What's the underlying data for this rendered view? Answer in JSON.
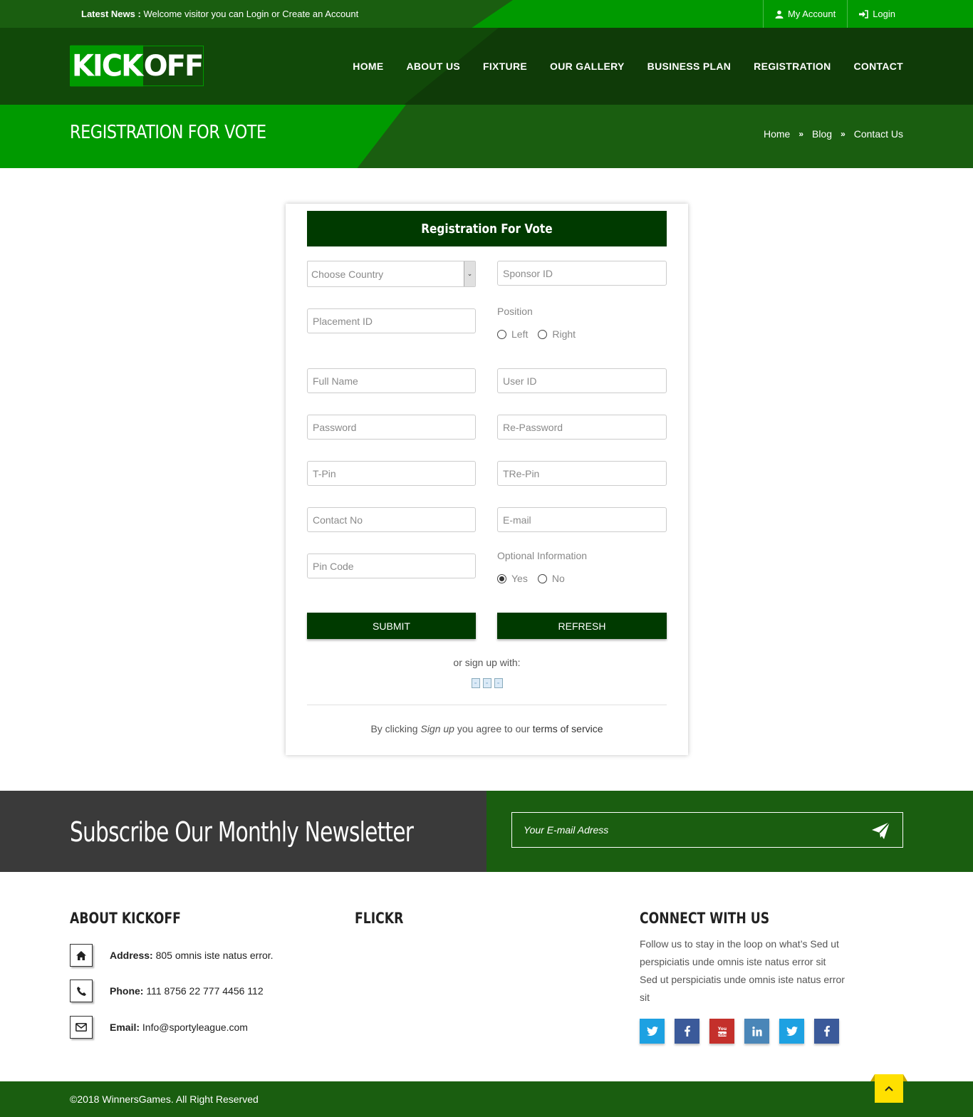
{
  "topbar": {
    "news_label": "Latest News :",
    "news_text": "Welcome visitor you can Login or Create an Account",
    "my_account": "My Account",
    "login": "Login"
  },
  "logo": {
    "part1": "KICK",
    "part2": "OFF"
  },
  "nav": [
    "HOME",
    "ABOUT US",
    "FIXTURE",
    "OUR GALLERY",
    "BUSINESS PLAN",
    "REGISTRATION",
    "CONTACT"
  ],
  "page": {
    "title": "REGISTRATION FOR VOTE",
    "breadcrumb": [
      "Home",
      "Blog",
      "Contact Us"
    ]
  },
  "form": {
    "heading": "Registration For Vote",
    "country_select": "Choose Country",
    "sponsor_id": "Sponsor ID",
    "placement_id": "Placement ID",
    "position_label": "Position",
    "position_options": [
      "Left",
      "Right"
    ],
    "full_name": "Full Name",
    "user_id": "User ID",
    "password": "Password",
    "re_password": "Re-Password",
    "t_pin": "T-Pin",
    "tre_pin": "TRe-Pin",
    "contact_no": "Contact No",
    "email": "E-mail",
    "pin_code": "Pin Code",
    "optional_label": "Optional Information",
    "optional_options": [
      "Yes",
      "No"
    ],
    "optional_selected": "Yes",
    "submit": "SUBMIT",
    "refresh": "REFRESH",
    "or_signup": "or sign up with:",
    "terms_prefix": "By clicking",
    "terms_em": "Sign up",
    "terms_mid": "you agree to our",
    "terms_link": "terms of service"
  },
  "newsletter": {
    "title": "Subscribe Our Monthly Newsletter",
    "placeholder": "Your E-mail Adress"
  },
  "footer": {
    "about_title": "ABOUT KICKOFF",
    "flickr_title": "FLICKR",
    "connect_title": "CONNECT WITH US",
    "address_label": "Address:",
    "address": "805 omnis iste natus error.",
    "phone_label": "Phone:",
    "phone": "111 8756 22 777 4456 112",
    "email_label": "Email:",
    "email": "Info@sportyleague.com",
    "follow_text": "Follow us to stay in the loop on what’s Sed ut perspiciatis unde omnis iste natus error sit Sed ut perspiciatis unde omnis iste natus error sit",
    "socials": [
      "twitter-icon",
      "facebook-icon",
      "youtube-icon",
      "linkedin-icon",
      "twitter-icon",
      "facebook-icon"
    ],
    "copyright": "©2018 WinnersGames. All Right Reserved"
  },
  "colors": {
    "brand_green": "#009a00",
    "dark_green": "#003a00",
    "mid_green": "#1a5e10",
    "accent_yellow": "#ffe000"
  }
}
